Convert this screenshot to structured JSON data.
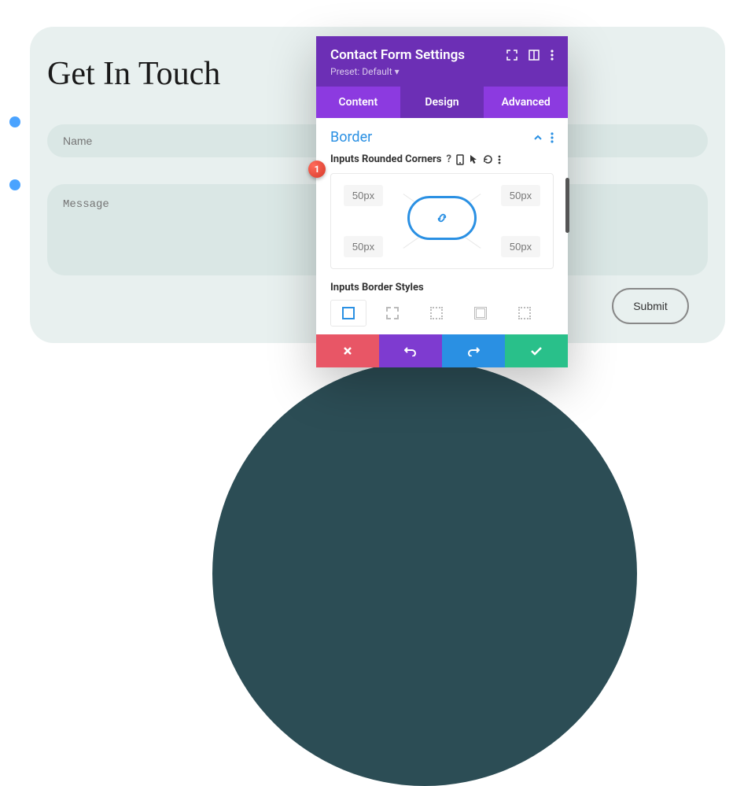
{
  "page": {
    "heading": "Get In Touch",
    "name_placeholder": "Name",
    "message_placeholder": "Message",
    "submit_label": "Submit"
  },
  "modal": {
    "title": "Contact Form Settings",
    "preset": "Preset: Default ▾",
    "tabs": {
      "content": "Content",
      "design": "Design",
      "advanced": "Advanced"
    },
    "section": {
      "title": "Border",
      "option_label": "Inputs Rounded Corners",
      "style_label": "Inputs Border Styles"
    },
    "corners": {
      "tl": "50px",
      "tr": "50px",
      "bl": "50px",
      "br": "50px"
    }
  },
  "annotation": {
    "badge": "1"
  }
}
